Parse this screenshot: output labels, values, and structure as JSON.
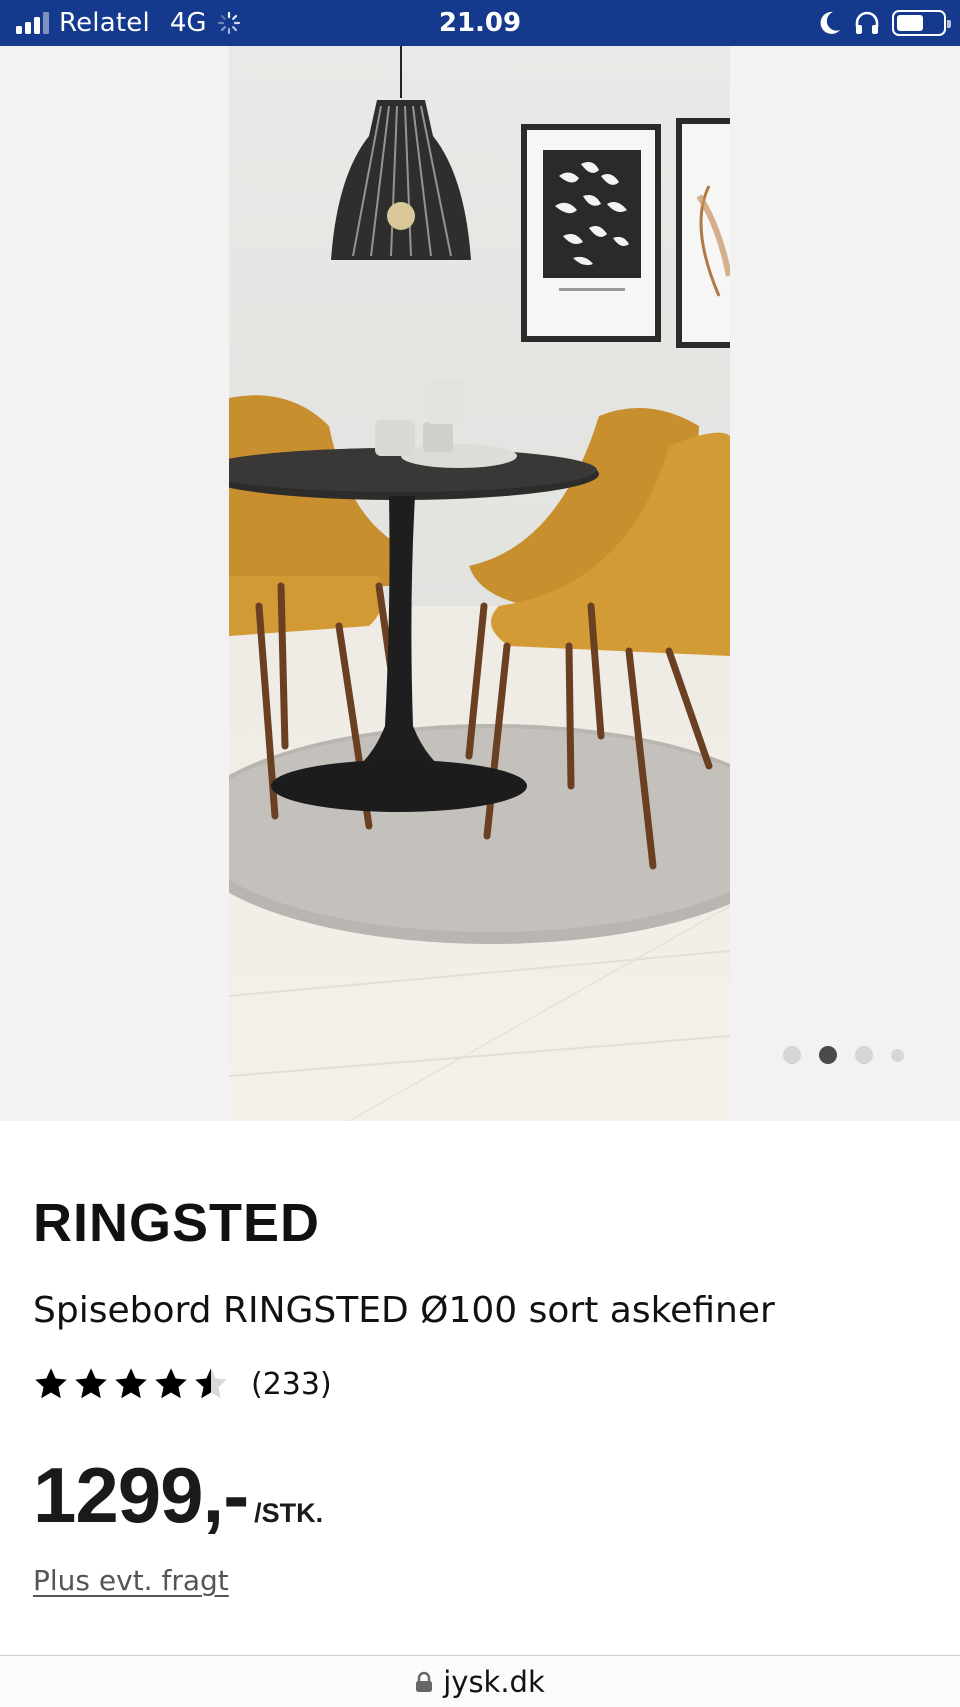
{
  "status_bar": {
    "carrier": "Relatel",
    "network": "4G",
    "time": "21.09",
    "icons": [
      "signal-icon",
      "loading-spinner-icon",
      "moon-icon",
      "headphones-icon",
      "battery-icon"
    ],
    "battery_level": 0.58
  },
  "gallery": {
    "image_alt": "product-photo-dining-table",
    "page_count": 4,
    "active_index": 1
  },
  "product": {
    "brand": "RINGSTED",
    "name": "Spisebord RINGSTED Ø100 sort askefiner",
    "rating": 4.5,
    "review_count": "(233)",
    "price": "1299,-",
    "price_unit": "/STK.",
    "shipping_note": "Plus evt. fragt"
  },
  "browser": {
    "url": "jysk.dk"
  },
  "colors": {
    "status_bar_bg": "#14398d",
    "gallery_bg": "#f2f2f2",
    "dot_active": "#4a4a4a",
    "dot_inactive": "#d6d6d6"
  }
}
